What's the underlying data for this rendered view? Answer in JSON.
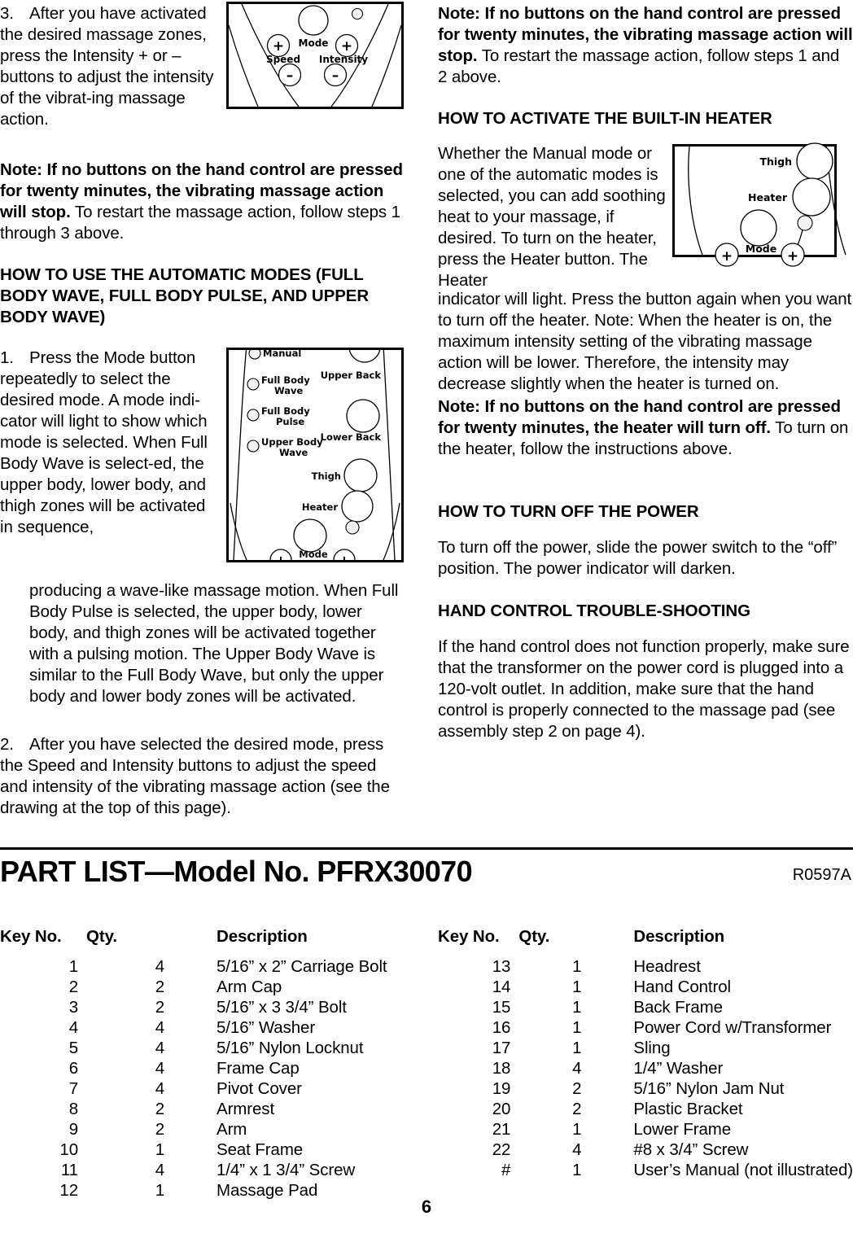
{
  "page": {
    "number": "6"
  },
  "left_column": {
    "step3": {
      "number": "3.",
      "text": "After you have activated the desired massage zones, press the Intensity + or – buttons to adjust the intensity of the vibrat-ing massage action."
    },
    "note1": {
      "bold": "Note: If no buttons on the hand control are pressed for twenty minutes, the vibrating massage action will stop.",
      "rest": " To restart the massage action, follow steps 1 through 3 above."
    },
    "heading_auto_modes": "HOW TO USE THE AUTOMATIC MODES (FULL BODY WAVE, FULL BODY PULSE, AND UPPER BODY WAVE)",
    "step1": {
      "number": "1.",
      "text_wrapped": "Press the Mode button repeatedly to select the desired mode. A mode indi-cator will light to show which mode is selected. When Full Body Wave is select-ed, the upper body, lower body, and thigh zones will be activated in sequence,",
      "text_full": "producing a wave-like massage motion. When Full Body Pulse is selected, the upper body, lower body, and thigh zones will be activated together with a pulsing motion. The Upper Body Wave is similar to the Full Body Wave, but only the upper body and lower body zones will be activated."
    },
    "step2": {
      "number": "2.",
      "text": "After you have selected the desired mode, press the Speed and Intensity buttons to adjust the speed and intensity of the vibrating massage action (see the drawing at the top of this page)."
    }
  },
  "right_column": {
    "note1": {
      "bold": "Note: If no buttons on the hand control are pressed for twenty minutes, the vibrating massage action will stop.",
      "rest": " To restart the massage action, follow steps 1 and 2 above."
    },
    "heading_heater": "HOW TO ACTIVATE THE BUILT-IN HEATER",
    "heater_para_wrapped": "Whether the Manual mode or one of the automatic modes is selected, you can add soothing heat to your massage, if desired. To turn on the heater, press the Heater button. The Heater",
    "heater_para_full": "indicator will light. Press the button again when you want to turn off the heater. Note: When the heater is on, the maximum intensity setting of the vibrating massage action will be lower. Therefore, the intensity may decrease slightly when the heater is turned on.",
    "note2": {
      "bold": "Note: If no buttons on the hand control are pressed for twenty minutes, the heater will turn off.",
      "rest": " To turn on the heater, follow the instructions above."
    },
    "heading_power_off": "HOW TO TURN OFF THE POWER",
    "power_off_para": "To turn off the power, slide the power switch to the “off” position. The power indicator will darken.",
    "heading_troubleshooting": "HAND CONTROL TROUBLE-SHOOTING",
    "troubleshooting_para": "If the hand control does not function properly, make sure that the transformer on the power cord is plugged into a 120-volt outlet. In addition, make sure that the hand control is properly connected to the massage pad (see assembly step 2 on page 4)."
  },
  "figures": {
    "speed_intensity": {
      "labels": {
        "mode": "Mode",
        "speed": "Speed",
        "intensity": "Intensity",
        "plus_left": "+",
        "minus_left": "–",
        "plus_right": "+",
        "minus_right": "–"
      }
    },
    "mode_panel": {
      "labels": {
        "manual": "Manual",
        "full_body_wave": "Full Body Wave",
        "full_body_wave_l1": "Full Body",
        "full_body_wave_l2": "Wave",
        "full_body_pulse_l1": "Full Body",
        "full_body_pulse_l2": "Pulse",
        "upper_body_wave_l1": "Upper Body",
        "upper_body_wave_l2": "Wave",
        "upper_back": "Upper Back",
        "lower_back": "Lower Back",
        "thigh": "Thigh",
        "heater": "Heater",
        "mode": "Mode",
        "plus_left": "+",
        "plus_right": "+"
      }
    },
    "heater_panel": {
      "labels": {
        "thigh": "Thigh",
        "heater": "Heater",
        "mode": "Mode",
        "plus_left": "+",
        "plus_right": "+"
      }
    }
  },
  "part_list": {
    "title": "PART LIST—Model No. PFRX30070",
    "revision": "R0597A",
    "headers": {
      "key": "Key No.",
      "qty": "Qty.",
      "description": "Description"
    },
    "rows_left": [
      {
        "key": "1",
        "qty": "4",
        "description": "5/16” x 2” Carriage Bolt"
      },
      {
        "key": "2",
        "qty": "2",
        "description": "Arm Cap"
      },
      {
        "key": "3",
        "qty": "2",
        "description": "5/16” x 3 3/4” Bolt"
      },
      {
        "key": "4",
        "qty": "4",
        "description": "5/16” Washer"
      },
      {
        "key": "5",
        "qty": "4",
        "description": "5/16” Nylon Locknut"
      },
      {
        "key": "6",
        "qty": "4",
        "description": "Frame Cap"
      },
      {
        "key": "7",
        "qty": "4",
        "description": "Pivot Cover"
      },
      {
        "key": "8",
        "qty": "2",
        "description": "Armrest"
      },
      {
        "key": "9",
        "qty": "2",
        "description": "Arm"
      },
      {
        "key": "10",
        "qty": "1",
        "description": "Seat Frame"
      },
      {
        "key": "11",
        "qty": "4",
        "description": "1/4” x 1 3/4” Screw"
      },
      {
        "key": "12",
        "qty": "1",
        "description": "Massage Pad"
      }
    ],
    "rows_right": [
      {
        "key": "13",
        "qty": "1",
        "description": "Headrest"
      },
      {
        "key": "14",
        "qty": "1",
        "description": "Hand Control"
      },
      {
        "key": "15",
        "qty": "1",
        "description": "Back Frame"
      },
      {
        "key": "16",
        "qty": "1",
        "description": "Power Cord w/Transformer"
      },
      {
        "key": "17",
        "qty": "1",
        "description": "Sling"
      },
      {
        "key": "18",
        "qty": "4",
        "description": "1/4” Washer"
      },
      {
        "key": "19",
        "qty": "2",
        "description": "5/16” Nylon Jam Nut"
      },
      {
        "key": "20",
        "qty": "2",
        "description": "Plastic Bracket"
      },
      {
        "key": "21",
        "qty": "1",
        "description": "Lower Frame"
      },
      {
        "key": "22",
        "qty": "4",
        "description": "#8 x 3/4” Screw"
      },
      {
        "key": "#",
        "qty": "1",
        "description": "User’s Manual (not illustrated)"
      }
    ]
  }
}
